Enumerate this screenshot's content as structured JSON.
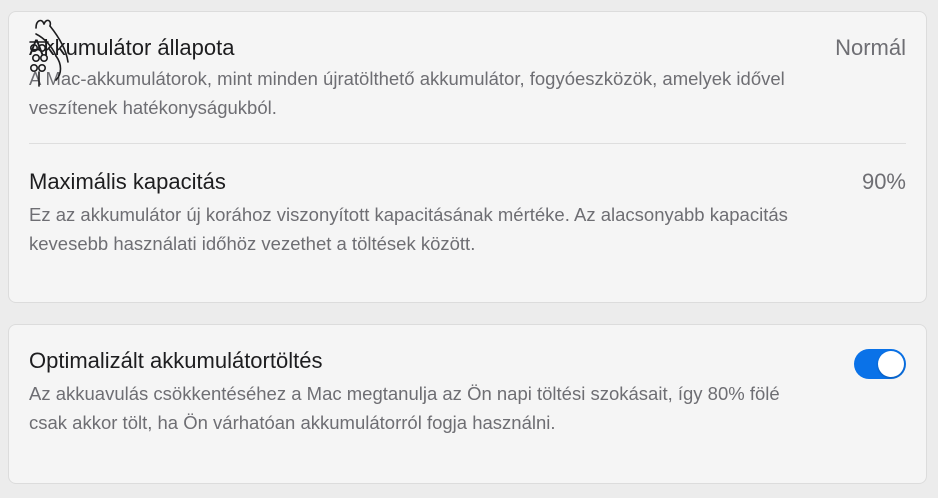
{
  "battery": {
    "health": {
      "title": "Akkumulátor állapota",
      "value": "Normál",
      "description": "A Mac-akkumulátorok, mint minden újratölthető akkumulátor, fogyóeszközök, amelyek idővel veszítenek hatékonyságukból."
    },
    "capacity": {
      "title": "Maximális kapacitás",
      "value": "90%",
      "description": "Ez az akkumulátor új korához viszonyított kapacitásának mértéke. Az alacsonyabb kapacitás kevesebb használati időhöz vezethet a töltések között."
    }
  },
  "charging": {
    "optimized": {
      "title": "Optimalizált akkumulátortöltés",
      "description": "Az akkuavulás csökkentéséhez a Mac megtanulja az Ön napi töltési szokásait, így 80% fölé csak akkor tölt, ha Ön várhatóan akkumulátorról fogja használni.",
      "enabled": true
    }
  },
  "colors": {
    "accent": "#0a72e8",
    "background": "#ececec",
    "card": "#f5f5f5",
    "primary_text": "#1d1d1f",
    "secondary_text": "#6e6e73"
  },
  "icons": {
    "logo": "line-art-logo-icon"
  }
}
